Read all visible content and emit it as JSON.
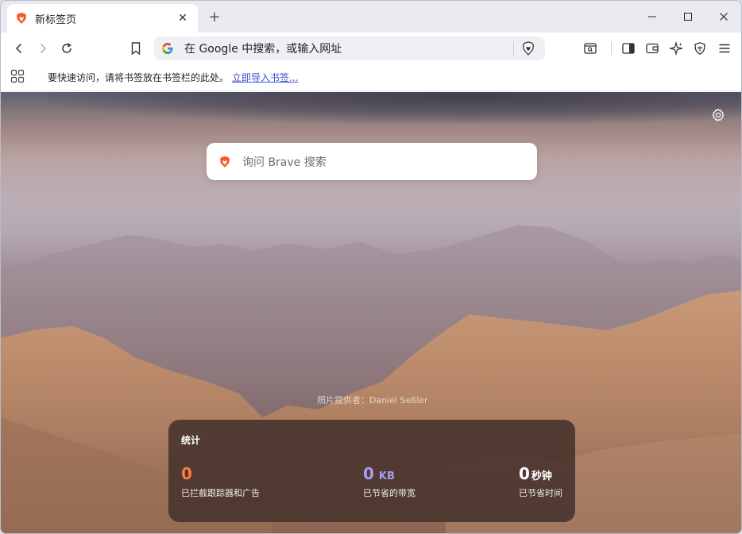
{
  "browser": {
    "tab": {
      "title": "新标签页",
      "close_glyph": "✕",
      "icon": "brave-lion-icon"
    },
    "newtab_glyph": "+",
    "window_controls": {
      "minimize_glyph": "—",
      "maximize_glyph": "☐",
      "close_glyph": "✕"
    }
  },
  "toolbar": {
    "omnibox_text": "在 Google 中搜索，或输入网址",
    "icons": [
      "back-icon",
      "forward-icon",
      "reload-icon",
      "bookmark-icon",
      "brave-shields-icon",
      "tab-search-icon",
      "sidebar-icon",
      "wallet-icon",
      "leo-ai-icon",
      "vpn-icon",
      "menu-icon"
    ]
  },
  "bookmarks_bar": {
    "message": "要快速访问，请将书签放在书签栏的此处。",
    "import_link": "立即导入书签..."
  },
  "newtab": {
    "search_placeholder": "询问 Brave 搜索",
    "photo_credit": "照片提供者：Daniel Seßler",
    "stats": {
      "title": "统计",
      "trackers": {
        "value": "0",
        "label": "已拦截跟踪器和广告"
      },
      "bandwidth": {
        "value": "0",
        "unit": "KB",
        "label": "已节省的带宽"
      },
      "time": {
        "value": "0",
        "unit": "秒钟",
        "label": "已节省时间"
      }
    }
  },
  "colors": {
    "brave_orange": "#fb542b",
    "trackers": "#ff7a45",
    "bandwidth": "#a79cf0",
    "link": "#3a4fd6"
  }
}
